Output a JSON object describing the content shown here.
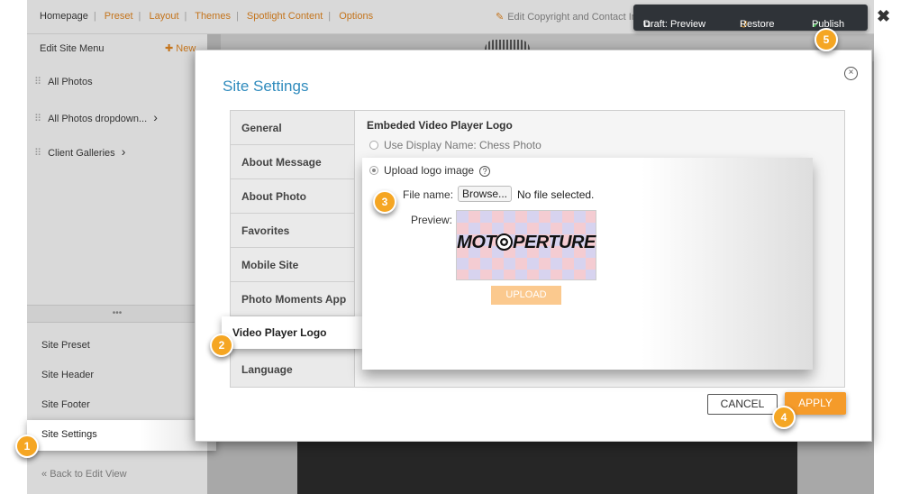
{
  "topbar": {
    "home": "Homepage",
    "nav": [
      "Preset",
      "Layout",
      "Themes",
      "Spotlight Content",
      "Options"
    ],
    "copyright": "Edit Copyright and Contact Info",
    "draft": "Draft: Preview",
    "restore": "Restore",
    "publish": "Publish",
    "close": "✖"
  },
  "sidebar": {
    "title": "Edit Site Menu",
    "new_label": "New",
    "items": [
      {
        "label": "All Photos",
        "chevron": ""
      },
      {
        "label": "All Photos dropdown...",
        "chevron": "›"
      },
      {
        "label": "Client Galleries",
        "chevron": "›"
      }
    ],
    "divider": "•••",
    "bottom": [
      "Site Preset",
      "Site Header",
      "Site Footer"
    ],
    "settings": "Site Settings",
    "back": "Back to Edit View"
  },
  "modal": {
    "title": "Site Settings",
    "close": "×",
    "tabs": [
      "General",
      "About Message",
      "About Photo",
      "Favorites",
      "Mobile Site",
      "Photo Moments App"
    ],
    "active_tab": "Video Player Logo",
    "tab_after": "Language",
    "section_title": "Embeded Video Player Logo",
    "option_display": "Use Display Name: Chess Photo",
    "option_upload": "Upload logo image",
    "help": "?",
    "file_label": "File name:",
    "browse": "Browse...",
    "no_file": "No file selected.",
    "preview_label": "Preview:",
    "logo_left": "MOT",
    "logo_right": "PERTURE",
    "upload": "UPLOAD",
    "cancel": "CANCEL",
    "apply": "APPLY"
  },
  "badges": [
    "1",
    "2",
    "3",
    "4",
    "5"
  ],
  "colors": {
    "accent": "#f5a623",
    "link": "#c4741c",
    "title_blue": "#2f8bbd",
    "apply": "#f59b2a"
  }
}
